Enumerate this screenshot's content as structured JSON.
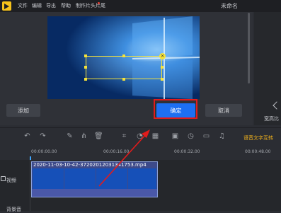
{
  "menu": [
    "文件",
    "编辑",
    "导出",
    "帮助",
    "制作片头片尾"
  ],
  "app_title": "未命名",
  "editor": {
    "add_label": "添加",
    "ok_label": "确定",
    "cancel_label": "取消"
  },
  "right_panel": {
    "aspect_label": "宽高比"
  },
  "toolbar": {
    "voice_label": "语音文字互转"
  },
  "ruler": {
    "timecodes": [
      "00:00:00.00",
      "00:00:16.00",
      "00:00:32.00",
      "00:00:48.00"
    ]
  },
  "tracks": {
    "video_label": "视频",
    "clip_name": "2020-11-03-10-42-37202012031341753.mp4",
    "music_label": "背景音"
  },
  "colors": {
    "accent": "#1d6ff2",
    "highlight": "#e21b1b",
    "voice_label": "#f2b21c"
  }
}
